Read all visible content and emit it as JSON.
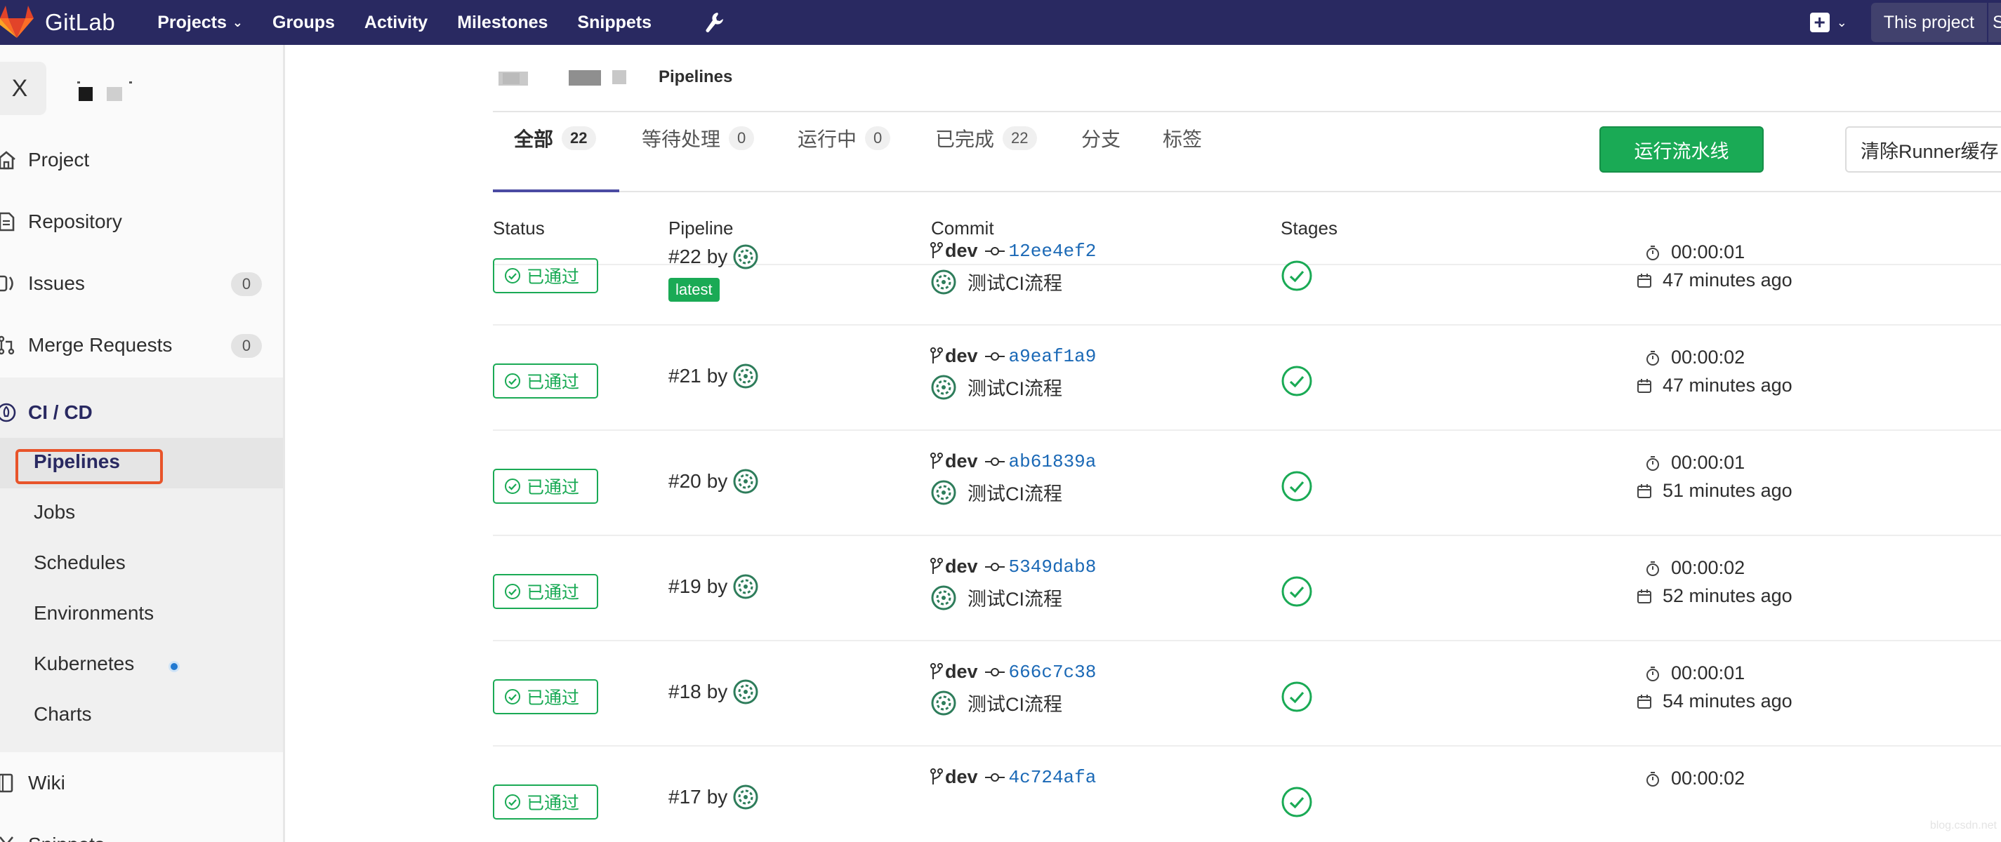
{
  "nav": {
    "brand": "GitLab",
    "links": [
      {
        "label": "Projects",
        "has_caret": true
      },
      {
        "label": "Groups"
      },
      {
        "label": "Activity"
      },
      {
        "label": "Milestones"
      },
      {
        "label": "Snippets"
      }
    ],
    "wrench_icon": "wrench-icon",
    "plus_icon": "plus-square-icon",
    "this_project": "This project",
    "search_stub": "S"
  },
  "sidebar": {
    "project_avatar_letter": "X",
    "items": [
      {
        "label": "Project",
        "icon": "home-icon"
      },
      {
        "label": "Repository",
        "icon": "document-icon"
      },
      {
        "label": "Issues",
        "icon": "issues-icon",
        "badge": "0"
      },
      {
        "label": "Merge Requests",
        "icon": "merge-request-icon",
        "badge": "0"
      },
      {
        "label": "CI / CD",
        "icon": "rocket-icon"
      },
      {
        "label": "Wiki",
        "icon": "book-icon"
      },
      {
        "label": "Snippets",
        "icon": "scissors-icon"
      }
    ],
    "cicd_sub": [
      "Pipelines",
      "Jobs",
      "Schedules",
      "Environments",
      "Kubernetes",
      "Charts"
    ]
  },
  "breadcrumb": {
    "current": "Pipelines"
  },
  "tabs": [
    {
      "label": "全部",
      "count": "22"
    },
    {
      "label": "等待处理",
      "count": "0"
    },
    {
      "label": "运行中",
      "count": "0"
    },
    {
      "label": "已完成",
      "count": "22"
    },
    {
      "label": "分支"
    },
    {
      "label": "标签"
    }
  ],
  "actions": {
    "run": "运行流水线",
    "clear": "清除Runner缓存"
  },
  "table": {
    "headers": [
      "Status",
      "Pipeline",
      "Commit",
      "Stages"
    ],
    "rows": [
      {
        "status": "已通过",
        "id": "#22",
        "by": "by",
        "latest": "latest",
        "branch": "dev",
        "sha": "12ee4ef2",
        "message": "测试CI流程",
        "duration": "00:00:01",
        "ago": "47 minutes ago"
      },
      {
        "status": "已通过",
        "id": "#21",
        "by": "by",
        "branch": "dev",
        "sha": "a9eaf1a9",
        "message": "测试CI流程",
        "duration": "00:00:02",
        "ago": "47 minutes ago"
      },
      {
        "status": "已通过",
        "id": "#20",
        "by": "by",
        "branch": "dev",
        "sha": "ab61839a",
        "message": "测试CI流程",
        "duration": "00:00:01",
        "ago": "51 minutes ago"
      },
      {
        "status": "已通过",
        "id": "#19",
        "by": "by",
        "branch": "dev",
        "sha": "5349dab8",
        "message": "测试CI流程",
        "duration": "00:00:02",
        "ago": "52 minutes ago"
      },
      {
        "status": "已通过",
        "id": "#18",
        "by": "by",
        "branch": "dev",
        "sha": "666c7c38",
        "message": "测试CI流程",
        "duration": "00:00:01",
        "ago": "54 minutes ago"
      },
      {
        "status": "已通过",
        "id": "#17",
        "by": "by",
        "branch": "dev",
        "sha": "4c724afa",
        "duration": "00:00:02"
      }
    ]
  },
  "colors": {
    "navbar": "#292961",
    "success": "#1aaa55",
    "link": "#1b69b6",
    "highlight": "#e8542a"
  }
}
